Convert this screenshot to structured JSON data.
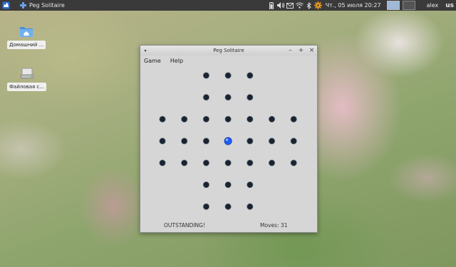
{
  "panel": {
    "task_title": "Peg Solitaire",
    "clock": "Чт., 05 июля  20:27",
    "user": "alex",
    "language": "us",
    "tray_icons": [
      "battery-icon",
      "volume-icon",
      "mail-icon",
      "wifi-icon",
      "bluetooth-icon",
      "settings-gear-icon"
    ]
  },
  "desktop": {
    "icons": [
      {
        "label": "Домашний ...",
        "icon": "home-folder-icon"
      },
      {
        "label": "Файловая с...",
        "icon": "drive-icon"
      }
    ]
  },
  "window": {
    "title": "Peg Solitaire",
    "menu": [
      "Game",
      "Help"
    ],
    "status": "OUTSTANDING!",
    "moves": "Moves: 31"
  },
  "board": {
    "layout": "english-cross",
    "holes": [
      "..ooo..",
      "..ooo..",
      "ooooooo",
      "oooPooo",
      "ooooooo",
      "..ooo..",
      "..ooo.."
    ],
    "hole_color": "#1a2430",
    "peg_color": "#1e5ef5"
  },
  "colors": {
    "panel_bg": "#3a3a3a",
    "window_bg": "#d6d6d6"
  }
}
